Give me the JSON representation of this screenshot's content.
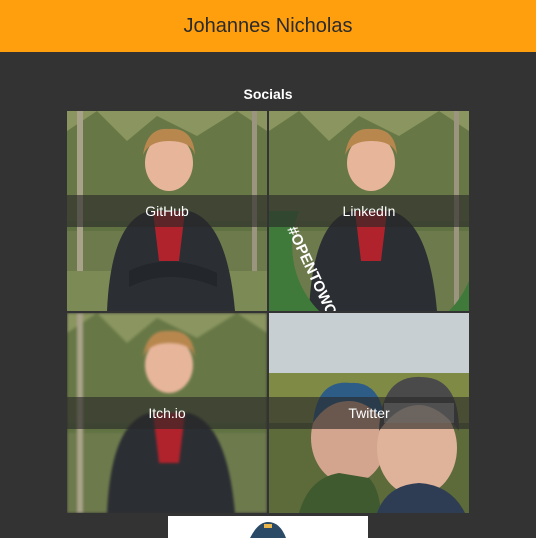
{
  "header": {
    "title": "Johannes Nicholas"
  },
  "section": {
    "title": "Socials"
  },
  "tiles": [
    {
      "label": "GitHub"
    },
    {
      "label": "LinkedIn",
      "badge_text": "#OPENTOWORK"
    },
    {
      "label": "Itch.io"
    },
    {
      "label": "Twitter"
    }
  ],
  "colors": {
    "header_bg": "#ff9f0d",
    "page_bg": "#333333",
    "badge_green": "#3f7a3a"
  }
}
